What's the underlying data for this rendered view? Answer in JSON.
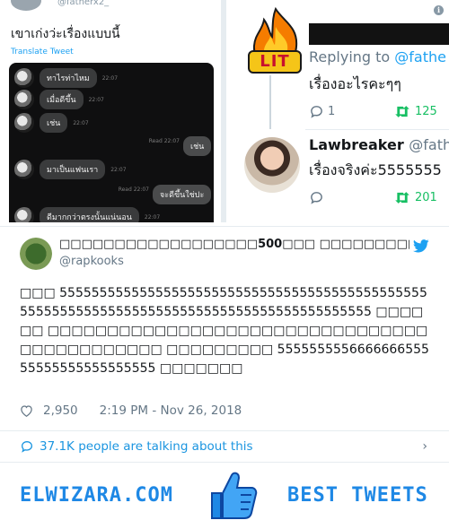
{
  "left_tweet": {
    "handle": "@fatherx2_",
    "text": "เขาเก่งว่ะเรื่องแบบนี้",
    "translate": "Translate Tweet",
    "chat": [
      {
        "from": "them",
        "text": "ทาไรท่าไหม",
        "time": "22:07"
      },
      {
        "from": "them",
        "text": "เมื่อดีขึ้น",
        "time": "22:07"
      },
      {
        "from": "them",
        "text": "เช่น",
        "time": "22:07"
      },
      {
        "from": "me",
        "text": "เช่น",
        "read": "Read 22:07"
      },
      {
        "from": "them",
        "text": "มาเป็นแฟนเรา",
        "time": "22:07"
      },
      {
        "from": "me",
        "text": "จะดีขึ้นใช่ปะ",
        "read": "Read 22:07"
      },
      {
        "from": "them",
        "text": "ดีมากกว่าตรงนั้นแน่นอน",
        "time": "22:07"
      }
    ]
  },
  "right_tweet": {
    "lit_label": "LIT",
    "replying_prefix": "Replying to ",
    "replying_handle": "@fathe",
    "reply_text": "เรื่องอะไรคะๆๆ",
    "reply_count": "1",
    "retweet_count_1": "125",
    "lawbreaker_name": "Lawbreaker",
    "lawbreaker_handle": "@fath",
    "lawbreaker_text": "เรื่องจริงค่ะ5555555",
    "retweet_count_2": "201"
  },
  "tweet": {
    "display_name": "□□□□□□□□□□□□□□□□□□500□□□ □□□□□□□□□□□□□□□",
    "handle": "@rapkooks",
    "body": "□□□ 555555555555555555555555555555555555555555555555555555555555555555555555555555555555555555 □□□□□□ □□□□□□□□□□□□□□□□□□□□□□□□□□□□□□□□□□□□□□□□□□□□ □□□□□□□□□ 555555555666666655555555555555555555 □□□□□□□",
    "likes": "2,950",
    "timestamp": "2:19 PM - Nov 26, 2018",
    "talking": "37.1K people are talking about this"
  },
  "banner": {
    "brand": "ELWIZARA.COM",
    "tagline": "BEST TWEETS"
  },
  "colors": {
    "twitter_blue": "#1da1f2",
    "link_blue": "#1b95e0",
    "retweet_green": "#17bf63",
    "banner_blue": "#1e88e5"
  }
}
